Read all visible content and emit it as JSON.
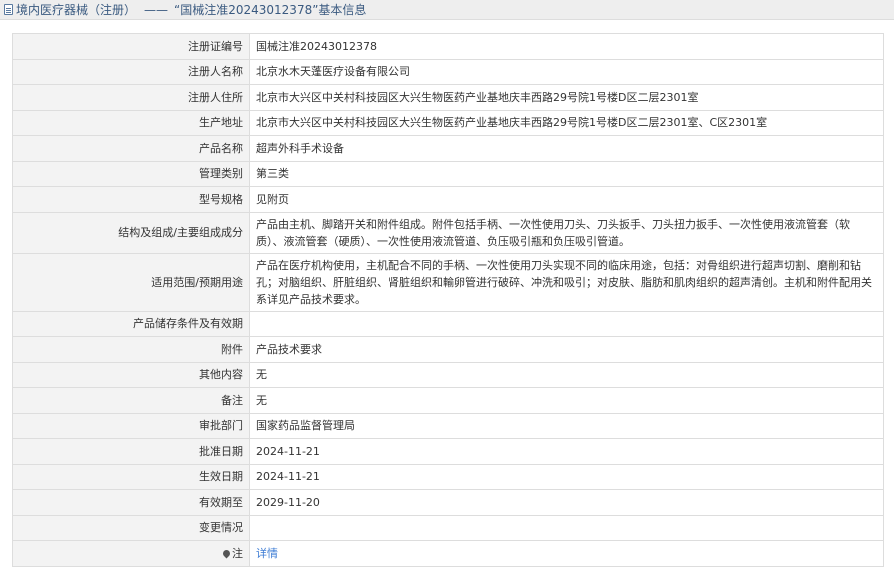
{
  "header": {
    "title_prefix": "境内医疗器械（注册）",
    "separator": "——",
    "title_main": "“国械注准20243012378”基本信息"
  },
  "rows": [
    {
      "key": "注册证编号",
      "value": "国械注准20243012378"
    },
    {
      "key": "注册人名称",
      "value": "北京水木天蓬医疗设备有限公司"
    },
    {
      "key": "注册人住所",
      "value": "北京市大兴区中关村科技园区大兴生物医药产业基地庆丰西路29号院1号楼D区二层2301室"
    },
    {
      "key": "生产地址",
      "value": "北京市大兴区中关村科技园区大兴生物医药产业基地庆丰西路29号院1号楼D区二层2301室、C区2301室"
    },
    {
      "key": "产品名称",
      "value": "超声外科手术设备"
    },
    {
      "key": "管理类别",
      "value": "第三类"
    },
    {
      "key": "型号规格",
      "value": "见附页"
    },
    {
      "key": "结构及组成/主要组成成分",
      "value": "产品由主机、脚踏开关和附件组成。附件包括手柄、一次性使用刀头、刀头扳手、刀头扭力扳手、一次性使用液流管套（软质）、液流管套（硬质）、一次性使用液流管道、负压吸引瓶和负压吸引管道。"
    },
    {
      "key": "适用范围/预期用途",
      "value": "产品在医疗机构使用，主机配合不同的手柄、一次性使用刀头实现不同的临床用途，包括：对骨组织进行超声切割、磨削和钻孔；对脑组织、肝脏组织、肾脏组织和輸卵管进行破碎、冲洗和吸引；对皮肤、脂肪和肌肉组织的超声清创。主机和附件配用关系详见产品技术要求。"
    },
    {
      "key": "产品储存条件及有效期",
      "value": ""
    },
    {
      "key": "附件",
      "value": "产品技术要求"
    },
    {
      "key": "其他内容",
      "value": "无"
    },
    {
      "key": "备注",
      "value": "无"
    },
    {
      "key": "审批部门",
      "value": "国家药品监督管理局"
    },
    {
      "key": "批准日期",
      "value": "2024-11-21"
    },
    {
      "key": "生效日期",
      "value": "2024-11-21"
    },
    {
      "key": "有效期至",
      "value": "2029-11-20"
    },
    {
      "key": "变更情况",
      "value": ""
    },
    {
      "key": "注",
      "value": "详情"
    }
  ],
  "icons": {
    "title_icon": "document-icon",
    "note_icon": "pin-icon"
  },
  "colors": {
    "link": "#3b7bd4",
    "title": "#3a5a80"
  }
}
